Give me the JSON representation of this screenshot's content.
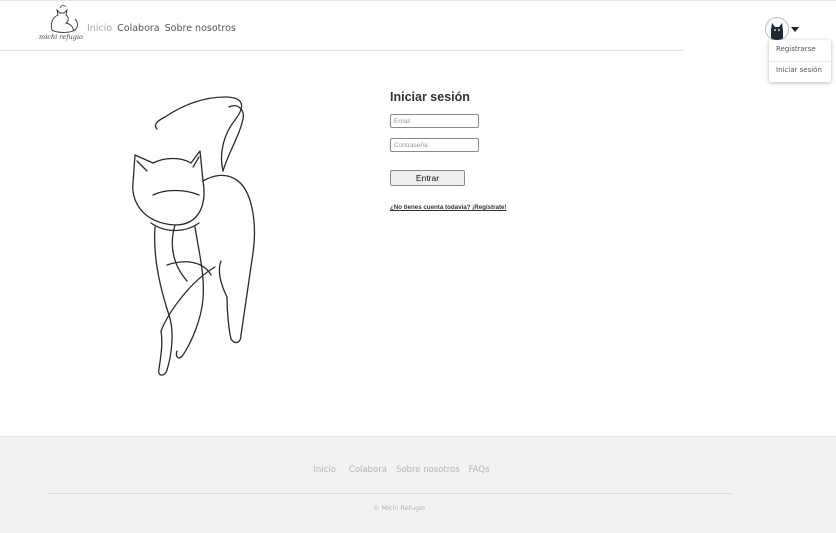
{
  "brand": {
    "logo_text": "michi refugio"
  },
  "nav": {
    "items": [
      "Inicio",
      "Colabora",
      "Sobre nosotros"
    ],
    "active": "Inicio"
  },
  "user_menu": {
    "items": [
      "Registrarse",
      "Iniciar sesión"
    ]
  },
  "login": {
    "title": "Iniciar sesión",
    "email_placeholder": "Email",
    "password_placeholder": "Contraseña",
    "submit_label": "Entrar",
    "register_link": "¿No tienes cuenta todavía? ¡Regístrate!"
  },
  "footer": {
    "links": [
      "Inicio",
      "Colabora",
      "Sobre nosotros",
      "FAQs"
    ],
    "copyright": "© Michi Refugio"
  },
  "colors": {
    "nav_active": "#a9a9a9",
    "footer_bg": "#f2f2f2",
    "footer_text": "#b4b4b4",
    "text": "#333333"
  }
}
